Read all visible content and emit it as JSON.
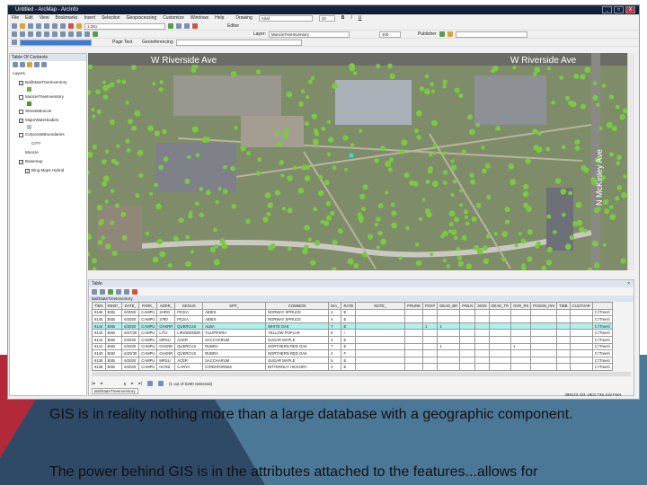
{
  "window": {
    "title": "Untitled - ArcMap - ArcInfo",
    "controls": [
      "_",
      "□",
      "X"
    ]
  },
  "menu": [
    "File",
    "Edit",
    "View",
    "Bookmarks",
    "Insert",
    "Selection",
    "Geoprocessing",
    "Customize",
    "Windows",
    "Help"
  ],
  "toolbar": {
    "scale": "1:251",
    "drawing_label": "Drawing",
    "font": "Arial",
    "font_size": "10",
    "editor_label": "Editor",
    "page_text": "Page Text",
    "georeferencing": "Georeferencing",
    "layer_label": "Layer:",
    "layer_value": "MuncieTreeInventory",
    "zoom_value": "100",
    "publisher": "Publisher"
  },
  "toc": {
    "title": "Table Of Contents",
    "items": [
      {
        "label": "Layers",
        "checked": null,
        "indent": 0
      },
      {
        "label": "BallStateTreeInventory",
        "checked": true,
        "indent": 1,
        "swatch": "#6cb33a"
      },
      {
        "label": "MuncieTreeInventory",
        "checked": false,
        "indent": 1,
        "swatch": "#4a9a2a"
      },
      {
        "label": "StreetsMuncie",
        "checked": false,
        "indent": 1
      },
      {
        "label": "MajorWaterbodies",
        "checked": true,
        "indent": 1,
        "swatch": "#9cc8e8"
      },
      {
        "label": "CorporateBoundaries",
        "checked": false,
        "indent": 1
      },
      {
        "label": "CITY",
        "checked": null,
        "indent": 3
      },
      {
        "label": "Muncie",
        "checked": null,
        "indent": 2
      },
      {
        "label": "Basemap",
        "checked": true,
        "indent": 1
      },
      {
        "label": "Bing Maps Hybrid",
        "checked": true,
        "indent": 2
      }
    ]
  },
  "map": {
    "labels": [
      "W Riverside Ave",
      "W Riverside Ave",
      "N McKinley Ave"
    ],
    "tree_color": "#7ac943",
    "selected_color": "#33dddd"
  },
  "table": {
    "panel_title": "Table",
    "layer_name": "BallStateTreeInventory",
    "columns": [
      "TIEN",
      "RESP_",
      "DATE_",
      "PARK_",
      "ADDR_",
      "GENUS",
      "SPP_",
      "COMMON",
      "DIA_",
      "RATE",
      "NOTE_",
      "PRUNE",
      "POST",
      "DEAD_BR",
      "PWLN",
      "SIGN",
      "DEAD_TR",
      "OVR_RS",
      "POSSN_INV",
      "TIBB",
      "CULTIVAR",
      ""
    ],
    "rows": [
      [
        "9146",
        "BSB",
        "6/2030",
        "CAMPU",
        "2HRO",
        "PICEA",
        "ABIES",
        "NORWAY SPRUCE",
        "4",
        "E",
        "",
        "",
        "",
        "",
        "",
        "",
        "",
        "",
        "",
        "",
        "",
        "C:\\Trees\\"
      ],
      [
        "9145",
        "BSB",
        "6/2030",
        "CAMPU",
        "2780",
        "PICEA",
        "ABIES",
        "NORWAY SPRUCE",
        "4",
        "E",
        "",
        "",
        "",
        "",
        "",
        "",
        "",
        "",
        "",
        "",
        "",
        "C:\\Trees\\"
      ],
      [
        "9144",
        "BSB",
        "6/2030",
        "CAMPU",
        "OAKRR",
        "QUERCUS",
        "ALBA",
        "WHITE OAK",
        "7",
        "E",
        "",
        "",
        "1",
        "1",
        "",
        "",
        "",
        "",
        "",
        "",
        "",
        "C:\\Trees\\"
      ],
      [
        "9143",
        "BSB",
        "6/27/30",
        "CAMPU",
        "LITU",
        "LIRIODENDR",
        "TULIPIFERA",
        "YELLOW POPLAR",
        "6",
        "I",
        "",
        "",
        "",
        "",
        "",
        "",
        "",
        "",
        "",
        "",
        "",
        "C:\\Trees\\"
      ],
      [
        "9142",
        "BSB",
        "6/2030",
        "CAMPU",
        "MRSU",
        "ACER",
        "SACCHARUM",
        "SUGAR MAPLE",
        "4",
        "E",
        "",
        "",
        "",
        "",
        "",
        "",
        "",
        "",
        "",
        "",
        "",
        "C:\\Trees\\"
      ],
      [
        "9141",
        "BSB",
        "6/2030",
        "CAMPU",
        "OAKNR",
        "QUERCUS",
        "RUBRA",
        "NORTHERN RED OAK",
        "7",
        "E",
        "",
        "",
        "",
        "1",
        "",
        "",
        "",
        "1",
        "",
        "",
        "",
        "C:\\Trees\\"
      ],
      [
        "9140",
        "BSB",
        "6/20/30",
        "CAMPU",
        "OAKNR",
        "QUERCUS",
        "RUBRA",
        "NORTHERN RED OAK",
        "4",
        "F",
        "",
        "",
        "",
        "",
        "",
        "",
        "",
        "",
        "",
        "",
        "",
        "C:\\Trees\\"
      ],
      [
        "9139",
        "BSB",
        "6/2030",
        "CAMPU",
        "MRSU",
        "ACER",
        "SACCHARUM",
        "SUGAR MAPLE",
        "5",
        "E",
        "",
        "",
        "",
        "",
        "",
        "",
        "",
        "",
        "",
        "",
        "",
        "C:\\Trees\\"
      ],
      [
        "9138",
        "BSB",
        "6/2030",
        "CAMPU",
        "HCRD",
        "CARYA",
        "CORDIFORMIS",
        "BITTERNUT HICKORY",
        "3",
        "E",
        "",
        "",
        "",
        "",
        "",
        "",
        "",
        "",
        "",
        "",
        "",
        "C:\\Trees\\"
      ]
    ],
    "selected_row": 2,
    "record": "5",
    "selection_status": "(1 out of 5290 Selected)"
  },
  "status_bar": "399123.431  1801:746.419 Feet",
  "slide": {
    "paragraphs": [
      "GIS is in reality nothing more than a large database with a geographic component.",
      "The power behind GIS is in the attributes attached to the features...allows for"
    ],
    "colors": {
      "red": "#b22a3a",
      "dark_blue": "#2f4a66",
      "steel_blue": "#4c7898"
    }
  }
}
